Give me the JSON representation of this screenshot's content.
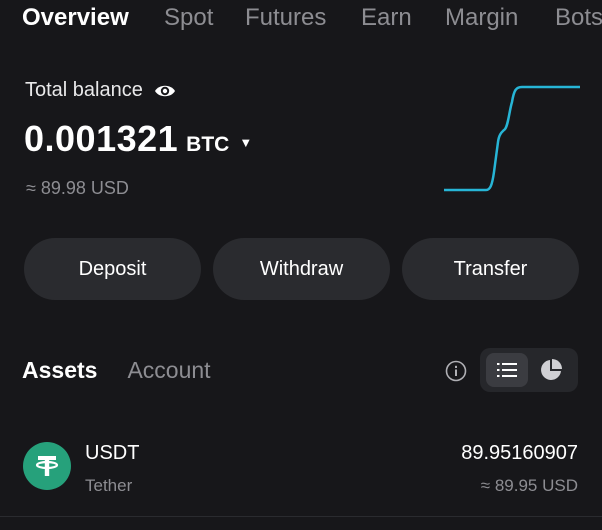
{
  "top_tabs": [
    "Overview",
    "Spot",
    "Futures",
    "Earn",
    "Margin",
    "Bots"
  ],
  "balance": {
    "label": "Total balance",
    "value": "0.001321",
    "unit": "BTC",
    "usd": "≈ 89.98 USD"
  },
  "actions": {
    "deposit": "Deposit",
    "withdraw": "Withdraw",
    "transfer": "Transfer"
  },
  "section_tabs": {
    "assets": "Assets",
    "account": "Account"
  },
  "assets": [
    {
      "symbol": "USDT",
      "name": "Tether",
      "amount": "89.95160907",
      "usd": "≈ 89.95 USD",
      "icon": "tether-icon",
      "color": "#26a17b"
    }
  ],
  "colors": {
    "background": "#17171a",
    "button": "#2a2b2f",
    "muted_text": "#8d8d92",
    "sparkline": "#27b5d6"
  },
  "icons": {
    "visibility": "eye-icon",
    "dropdown": "caret-down-icon",
    "info": "info-icon",
    "list_view": "list-icon",
    "chart_view": "pie-chart-icon"
  }
}
